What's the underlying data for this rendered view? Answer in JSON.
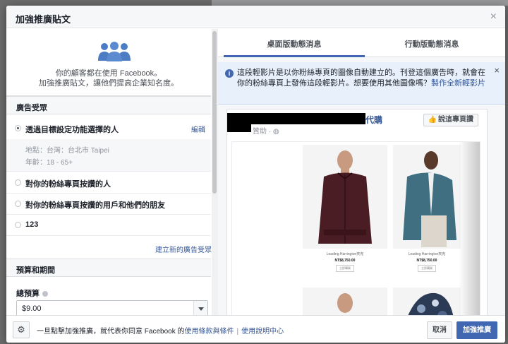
{
  "dialog": {
    "title": "加強推廣貼文",
    "close_icon": "×"
  },
  "intro": {
    "line1": "你的顧客都在使用 Facebook。",
    "line2": "加強推廣貼文，讓他們提高企業知名度。"
  },
  "audience": {
    "section_title": "廣告受眾",
    "edit_label": "編輯",
    "items": [
      {
        "label": "透過目標設定功能選擇的人",
        "selected": true
      },
      {
        "label": "對你的粉絲專頁按讚的人",
        "selected": false
      },
      {
        "label": "對你的粉絲專頁按讚的用戶和他們的朋友",
        "selected": false
      },
      {
        "label": "123",
        "selected": false
      }
    ],
    "detail_location": "地點：台灣：台北市 Taipei",
    "detail_age": "年齡：18 - 65+",
    "create_link": "建立新的廣告受眾"
  },
  "budget": {
    "section_title": "預算和期間",
    "total_label": "總預算",
    "value": "$9.00"
  },
  "tabs": [
    {
      "label": "桌面版動態消息",
      "active": true
    },
    {
      "label": "行動版動態消息",
      "active": false
    }
  ],
  "notice": {
    "text": "這段輕影片是以你粉絲專頁的圖像自動建立的。刊登這個廣告時，就會在你的粉絲專頁上發佈這段輕影片。想要使用其他圖像嗎？",
    "link": "製作全新輕影片",
    "close_icon": "×"
  },
  "post": {
    "page_name_suffix": "代購",
    "sponsored": "贊助 · ",
    "like_label": "說這專頁讚",
    "products": [
      {
        "name": "Leading Harrington夾克",
        "price": "NT$8,750.00",
        "button": "立即購買"
      },
      {
        "name": "Leading Harrington夾克",
        "price": "NT$8,750.00",
        "button": "立即購買"
      }
    ]
  },
  "footer": {
    "text_prefix": "一旦點擊加強推廣，就代表你同意 Facebook 的",
    "terms_link": "使用條款與條件",
    "separator": "|",
    "help_link": "使用說明中心",
    "cancel_label": "取消",
    "boost_label": "加強推廣"
  },
  "colors": {
    "brand": "#4267b2",
    "link": "#365899"
  }
}
